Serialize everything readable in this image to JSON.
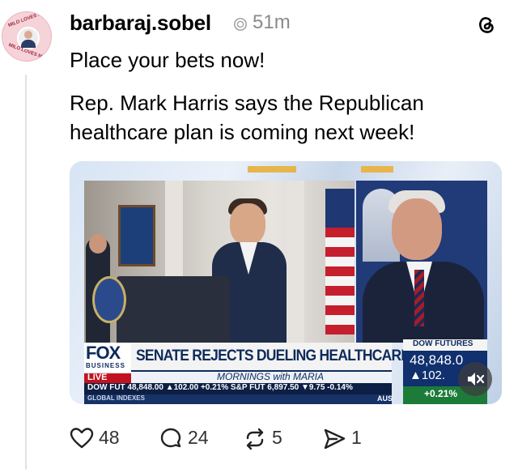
{
  "post": {
    "username": "barbaraj.sobel",
    "time": "51m",
    "line1": "Place your bets now!",
    "line2": "Rep. Mark Harris says the Republican",
    "line3": "healthcare plan is coming next week!"
  },
  "avatar": {
    "ring_top": "MILO LOVES ME",
    "ring_bottom": "MILO LOVES ME"
  },
  "video": {
    "network_logo": "FOX",
    "network_sub": "BUSINESS",
    "live": "LIVE",
    "headline": "SENATE REJECTS DUELING HEALTHCARE BILLS",
    "show": "MORNINGS with MARIA",
    "ticker": "DOW FUT 48,848.00 ▲102.00 +0.21%  S&P FUT  6,897.50 ▼9.75 -0.14%",
    "global": "GLOBAL INDEXES",
    "aus": "AUS",
    "dow_label": "DOW FUTURES",
    "dow_value": "48,848.0",
    "dow_change": "▲102.",
    "dow_pct": "+0.21%"
  },
  "actions": {
    "likes": "48",
    "replies": "24",
    "reposts": "5",
    "shares": "1"
  },
  "colors": {
    "fox_navy": "#0e2a5c",
    "live_red": "#c2121f",
    "up_green": "#1d7b3a"
  }
}
